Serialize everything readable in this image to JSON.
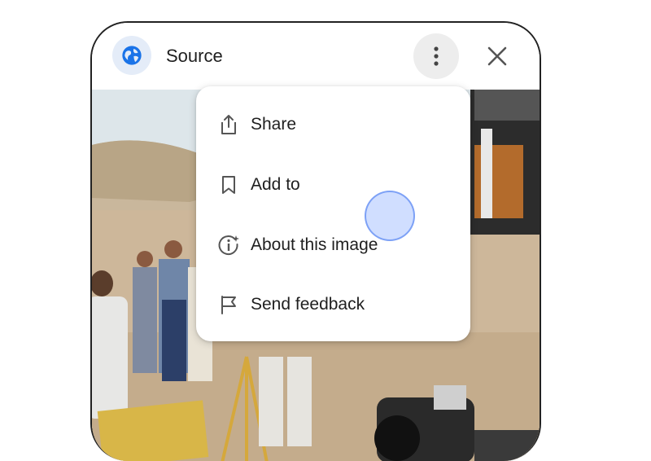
{
  "header": {
    "source_label": "Source",
    "source_icon": "globe-icon",
    "more_icon": "more-vert-icon",
    "close_icon": "close-icon"
  },
  "menu": {
    "items": [
      {
        "label": "Share",
        "icon": "share-icon"
      },
      {
        "label": "Add to",
        "icon": "bookmark-icon"
      },
      {
        "label": "About this image",
        "icon": "info-sparkle-icon"
      },
      {
        "label": "Send feedback",
        "icon": "flag-icon"
      }
    ]
  },
  "colors": {
    "accent_blue": "#1a73e8",
    "source_icon_bg": "#e4ecf8",
    "more_button_bg": "#ededed",
    "menu_bg": "#ffffff",
    "text": "#1f1f1f"
  }
}
